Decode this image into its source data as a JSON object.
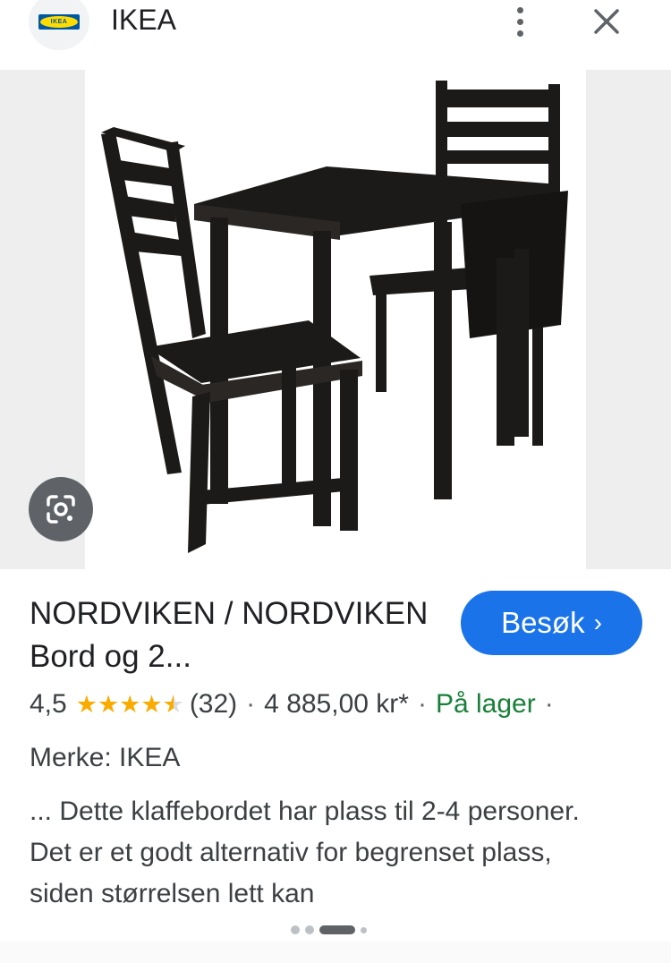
{
  "header": {
    "logo_text": "IKEA",
    "site_name": "IKEA",
    "more_icon": "more-vert-icon",
    "close_icon": "close-icon"
  },
  "image": {
    "lens_icon": "google-lens-icon"
  },
  "product": {
    "title": "NORDVIKEN / NORDVIKEN Bord og 2...",
    "visit_label": "Besøk",
    "visit_chevron": "›",
    "rating": "4,5",
    "rating_value": 4.5,
    "review_count": "(32)",
    "separator": "·",
    "price": "4 885,00 kr*",
    "stock": "På lager",
    "brand": "Merke: IKEA",
    "description": "... Dette klaffebordet har plass til 2-4 personer. Det er et godt alternativ for begrenset plass, siden størrelsen lett kan"
  },
  "carousel": {
    "count": 4,
    "active_index": 2
  },
  "colors": {
    "accent": "#1a73e8",
    "star": "#f9ab00",
    "stock": "#188038",
    "ikea_blue": "#0058a3",
    "ikea_yellow": "#ffdb00"
  }
}
